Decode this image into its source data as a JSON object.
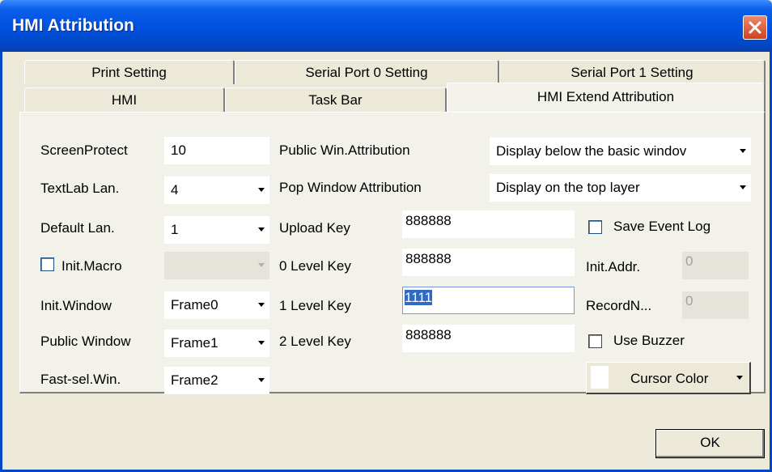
{
  "window": {
    "title": "HMI Attribution"
  },
  "tabs_back": [
    "Print Setting",
    "Serial Port 0 Setting",
    "Serial Port 1 Setting"
  ],
  "tabs_front": [
    "HMI",
    "Task Bar",
    "HMI Extend Attribution"
  ],
  "active_tab": "HMI Extend Attribution",
  "left": {
    "screen_protect": {
      "label": "ScreenProtect",
      "value": "10"
    },
    "textlab_lan": {
      "label": "TextLab Lan.",
      "value": "4"
    },
    "default_lan": {
      "label": "Default Lan.",
      "value": "1"
    },
    "init_macro": {
      "label": "Init.Macro",
      "checked": false,
      "value": ""
    },
    "init_window": {
      "label": "Init.Window",
      "value": "Frame0"
    },
    "public_window": {
      "label": "Public Window",
      "value": "Frame1"
    },
    "fast_sel_win": {
      "label": "Fast-sel.Win.",
      "value": "Frame2"
    }
  },
  "middle": {
    "public_win_attr": {
      "label": "Public Win.Attribution",
      "value": "Display below the basic windov"
    },
    "pop_window_attr": {
      "label": "Pop Window Attribution",
      "value": "Display on the top layer"
    },
    "upload_key": {
      "label": "Upload Key",
      "value": "888888"
    },
    "level0_key": {
      "label": "0 Level Key",
      "value": "888888"
    },
    "level1_key": {
      "label": "1 Level Key",
      "value": "1111"
    },
    "level2_key": {
      "label": "2 Level Key",
      "value": "888888"
    }
  },
  "right": {
    "save_event_log": {
      "label": "Save Event Log",
      "checked": false
    },
    "init_addr": {
      "label": "Init.Addr.",
      "value": "0"
    },
    "record_n": {
      "label": "RecordN...",
      "value": "0"
    },
    "use_buzzer": {
      "label": "Use Buzzer",
      "checked": false
    },
    "cursor_color": {
      "label": "Cursor Color",
      "color": "#ffffff"
    }
  },
  "footer": {
    "ok_label": "OK"
  }
}
